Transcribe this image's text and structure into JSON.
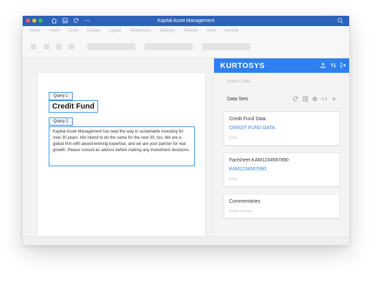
{
  "window": {
    "title": "Kapital Asset Management",
    "traffic_light_colors": [
      "#fc605c",
      "#fdbc40",
      "#34c84a"
    ],
    "titlebar_icons": [
      "home-icon",
      "save-icon",
      "refresh-icon",
      "more-icon"
    ]
  },
  "menu": [
    "Home",
    "Insert",
    "Draw",
    "Design",
    "Layout",
    "References",
    "Mailings",
    "Review",
    "View",
    "Acrobat"
  ],
  "document": {
    "query1_label": "Query 1",
    "heading": "Credit Fund",
    "query2_label": "Query 2",
    "paragraph": "Kapital Asset Management has lead the way in sustainable investing for over 30 years. We intend to do the same for the next 30, too. We are a global firm with award-winning expertise, and we are your partner for real growth. Please consult an advisor before making any investment decisions."
  },
  "panel": {
    "brand": "KURTOSYS",
    "brand_color": "#2f7ff0",
    "breadcrumb": "Home / Data",
    "datasets_title": "Data Sets",
    "cards": [
      {
        "title": "Credit Fund Data",
        "link": "CREDIT FUND DATA",
        "type": "Entity"
      },
      {
        "title": "Factsheet KAM1234567890",
        "link": "KAM1234567890",
        "type": "Entity"
      },
      {
        "title": "Commentaries",
        "link": "",
        "type": "Global Content"
      }
    ]
  }
}
